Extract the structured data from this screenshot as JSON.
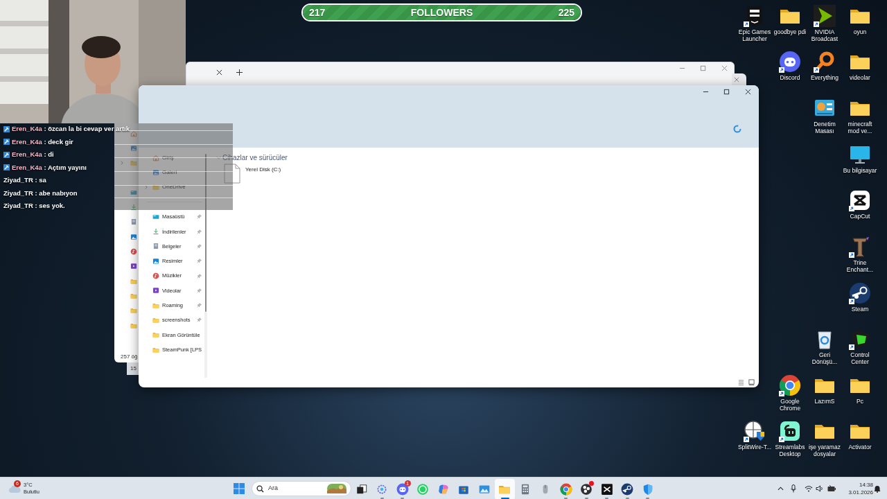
{
  "stream_overlay": {
    "follower_goal": {
      "current": "217",
      "label": "FOLLOWERS",
      "target": "225",
      "level": 1
    },
    "chat": [
      {
        "user": "Eren_K4a",
        "message": ": özcan la bi cevap ver artık",
        "badge": true,
        "color": "#f4b6c2"
      },
      {
        "user": "Eren_K4a",
        "message": ": deck gir",
        "badge": true,
        "color": "#f4b6c2"
      },
      {
        "user": "Eren_K4a",
        "message": ": di",
        "badge": true,
        "color": "#f4b6c2"
      },
      {
        "user": "Eren_K4a",
        "message": ": Açtım yayını",
        "badge": true,
        "color": "#f4b6c2"
      },
      {
        "user": "Ziyad_TR",
        "message": ": sa",
        "badge": false,
        "color": "#ffffff"
      },
      {
        "user": "Ziyad_TR",
        "message": ": abe nabıyon",
        "badge": false,
        "color": "#ffffff"
      },
      {
        "user": "Ziyad_TR",
        "message": ": ses yok.",
        "badge": false,
        "color": "#ffffff"
      }
    ]
  },
  "back_explorer": {
    "status": "257 öğ",
    "status_2": "15"
  },
  "explorer": {
    "loading": true,
    "sidebar": {
      "top_items": [
        {
          "label": "Giriş",
          "kind": "home",
          "expandable": false
        },
        {
          "label": "Galeri",
          "kind": "gallery",
          "expandable": false
        },
        {
          "label": "OneDrive",
          "kind": "folder",
          "expandable": true
        }
      ],
      "quick_access": [
        {
          "label": "Masaüstü",
          "kind": "desktop",
          "pinned": true
        },
        {
          "label": "İndirilenler",
          "kind": "download",
          "pinned": true
        },
        {
          "label": "Belgeler",
          "kind": "documents",
          "pinned": true
        },
        {
          "label": "Resimler",
          "kind": "pictures",
          "pinned": true
        },
        {
          "label": "Müzikler",
          "kind": "music",
          "pinned": true
        },
        {
          "label": "Videolar",
          "kind": "videos",
          "pinned": true
        },
        {
          "label": "Roaming",
          "kind": "folder",
          "pinned": true
        },
        {
          "label": "screenshots",
          "kind": "folder",
          "pinned": true
        },
        {
          "label": "Ekran Görüntüle",
          "kind": "folder",
          "pinned": false
        },
        {
          "label": "SteamPunk [LPS",
          "kind": "folder",
          "pinned": false
        }
      ]
    },
    "section": {
      "title": "Cihazlar ve sürücüler",
      "expanded": true,
      "drives": [
        {
          "label": "Yerel Disk (C:)"
        }
      ]
    }
  },
  "desktop_icons": [
    {
      "label": "Epic Games Launcher",
      "kind": "epic",
      "shortcut": true
    },
    {
      "label": "goodbye pdi",
      "kind": "folder",
      "shortcut": false
    },
    {
      "label": "NVIDIA Broadcast",
      "kind": "nvidia",
      "shortcut": true
    },
    {
      "label": "oyun",
      "kind": "folder",
      "shortcut": false
    },
    {
      "label": "Discord",
      "kind": "discord",
      "shortcut": true
    },
    {
      "label": "Everything",
      "kind": "everything",
      "shortcut": true
    },
    {
      "label": "videolar",
      "kind": "folder",
      "shortcut": false
    },
    {
      "label": "Denetim Masası",
      "kind": "control_panel",
      "shortcut": false
    },
    {
      "label": "minecraft mod ve...",
      "kind": "folder",
      "shortcut": false
    },
    {
      "label": "Bu bilgisayar",
      "kind": "monitor",
      "shortcut": false
    },
    {
      "label": "CapCut",
      "kind": "capcut",
      "shortcut": true
    },
    {
      "label": "Trine Enchant...",
      "kind": "trine",
      "shortcut": true
    },
    {
      "label": "Steam",
      "kind": "steam",
      "shortcut": true
    },
    {
      "label": "Geri Dönüşü...",
      "kind": "recycle",
      "shortcut": false
    },
    {
      "label": "Control Center",
      "kind": "control_center",
      "shortcut": true
    },
    {
      "label": "Google Chrome",
      "kind": "chrome",
      "shortcut": true
    },
    {
      "label": "LazımS",
      "kind": "folder",
      "shortcut": false
    },
    {
      "label": "Pc",
      "kind": "folder",
      "shortcut": false
    },
    {
      "label": "SplitWire-T...",
      "kind": "splitwire",
      "shortcut": true
    },
    {
      "label": "Streamlabs Desktop",
      "kind": "streamlabs",
      "shortcut": true
    },
    {
      "label": "işe yaramaz dosyalar",
      "kind": "folder",
      "shortcut": false
    },
    {
      "label": "Activator",
      "kind": "folder",
      "shortcut": false
    }
  ],
  "taskbar": {
    "weather": {
      "badge": "6",
      "temperature": "3°C",
      "condition": "Bulutlu"
    },
    "search": {
      "placeholder": "Ara"
    },
    "apps": [
      {
        "kind": "task_view",
        "running": false,
        "active": false,
        "alert": false
      },
      {
        "kind": "network",
        "running": true,
        "active": false,
        "alert": false
      },
      {
        "kind": "discord",
        "running": true,
        "active": false,
        "alert": false,
        "badge": "1"
      },
      {
        "kind": "whatsapp",
        "running": false,
        "active": false,
        "alert": false
      },
      {
        "kind": "copilot",
        "running": false,
        "active": false,
        "alert": false
      },
      {
        "kind": "store",
        "running": false,
        "active": false,
        "alert": false
      },
      {
        "kind": "photos",
        "running": false,
        "active": false,
        "alert": false
      },
      {
        "kind": "folder",
        "running": true,
        "active": true,
        "alert": false
      },
      {
        "kind": "calculator",
        "running": false,
        "active": false,
        "alert": false
      },
      {
        "kind": "mouse",
        "running": false,
        "active": false,
        "alert": false
      },
      {
        "kind": "chrome",
        "running": true,
        "active": false,
        "alert": false
      },
      {
        "kind": "obs",
        "running": true,
        "active": false,
        "alert": true
      },
      {
        "kind": "capcut_dark",
        "running": true,
        "active": false,
        "alert": false
      },
      {
        "kind": "steam",
        "running": true,
        "active": false,
        "alert": false
      },
      {
        "kind": "shield",
        "running": true,
        "active": false,
        "alert": false
      }
    ],
    "clock": {
      "time": "14:38",
      "date": "3.01.2026"
    }
  }
}
